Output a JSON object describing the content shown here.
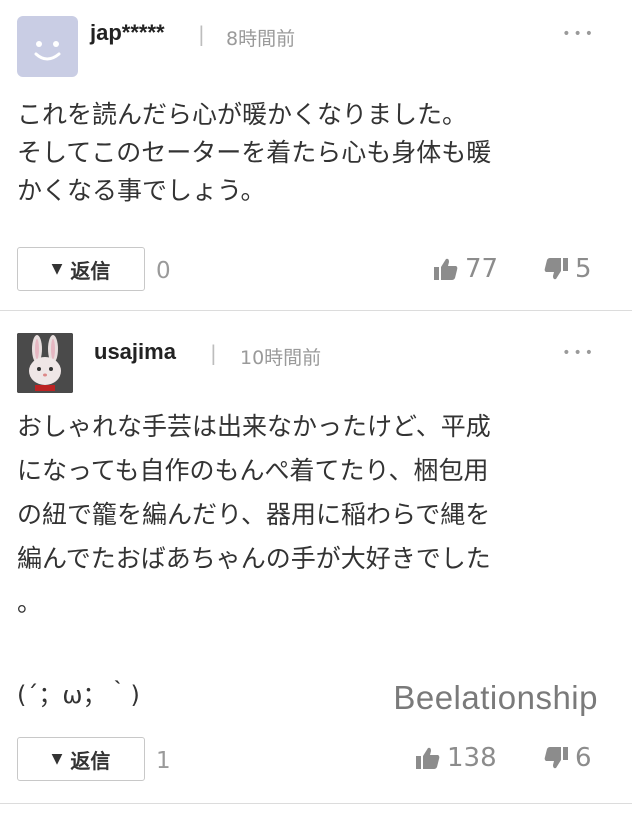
{
  "comments": [
    {
      "username": "jap*****",
      "separator": "|",
      "time": "8時間前",
      "more": "•••",
      "body": "これを読んだら心が暖かくなりました。\nそしてこのセーターを着たら心も身体も暖\nかくなる事でしょう。",
      "reply_label": "返信",
      "reply_arrow": "▼",
      "reply_count": "0",
      "likes": "77",
      "dislikes": "5"
    },
    {
      "username": "usajima",
      "separator": "|",
      "time": "10時間前",
      "more": "•••",
      "body": "おしゃれな手芸は出来なかったけど、平成\nになっても自作のもんぺ着てたり、梱包用\nの紐で籠を編んだり、器用に稲わらで縄を\n編んでたおばあちゃんの手が大好きでした\n。",
      "emoticon": "(´；ω；｀)",
      "watermark": "Beelationship",
      "reply_label": "返信",
      "reply_arrow": "▼",
      "reply_count": "1",
      "likes": "138",
      "dislikes": "6"
    }
  ],
  "colors": {
    "avatar_default": "#c9cde4",
    "muted": "#9a9a9a",
    "border": "#dcdcdc"
  }
}
